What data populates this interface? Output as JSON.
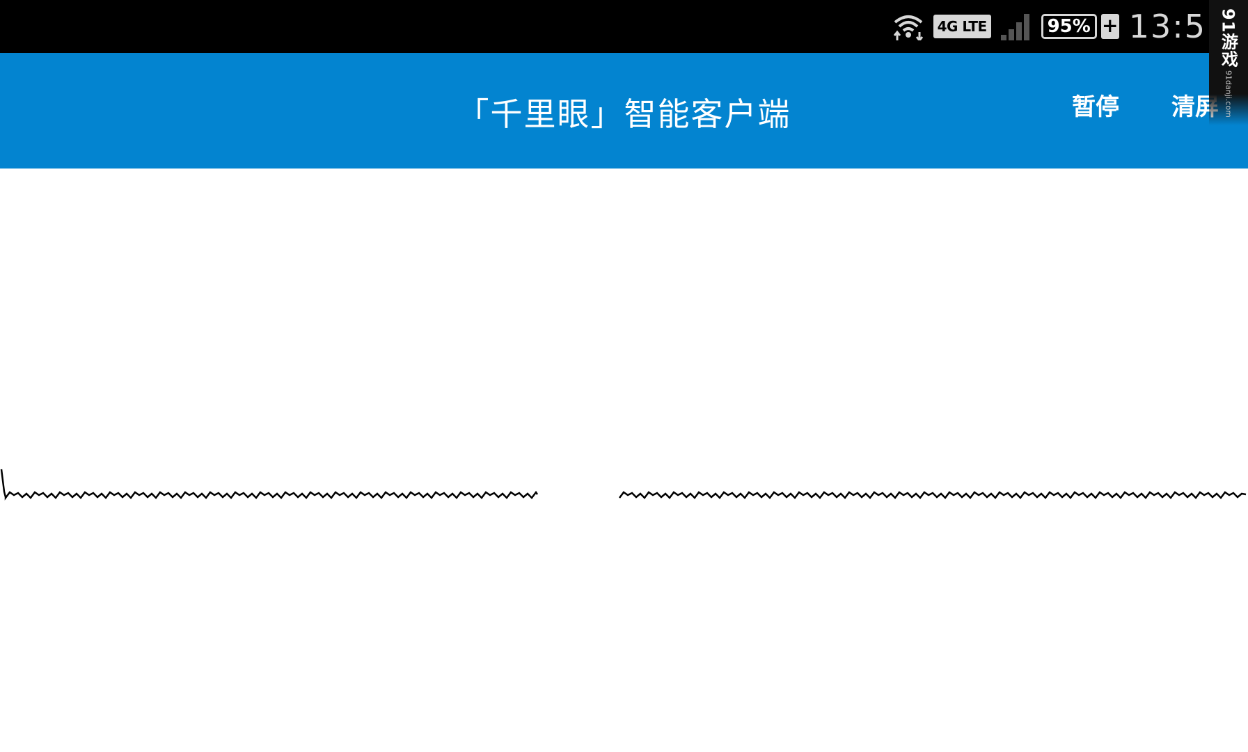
{
  "status_bar": {
    "network_badge": "4G LTE",
    "battery_percent": "95%",
    "battery_level": 0.95,
    "charging_symbol": "+",
    "clock": "13:5",
    "icons": [
      "wifi-icon",
      "signal-icon",
      "battery-icon",
      "charging-icon"
    ]
  },
  "action_bar": {
    "title": "「千里眼」智能客户端",
    "pause_label": "暂停",
    "clear_label": "清屏",
    "background_color": "#0384d0"
  },
  "watermark": {
    "logo": "91游戏",
    "url": "91danji.com"
  },
  "waveform": {
    "color": "#000000",
    "gap_visible": true
  }
}
